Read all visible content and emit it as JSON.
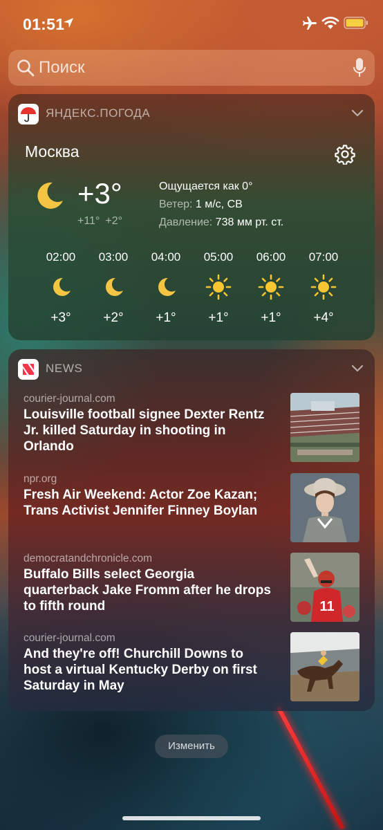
{
  "status": {
    "time": "01:51"
  },
  "search": {
    "placeholder": "Поиск"
  },
  "weather": {
    "app_name": "ЯНДЕКС.ПОГОДА",
    "city": "Москва",
    "current_temp": "+3°",
    "high": "+11°",
    "low": "+2°",
    "feels_like": "Ощущается как 0°",
    "wind_label": "Ветер:",
    "wind_value": "1 м/с, СВ",
    "pressure_label": "Давление:",
    "pressure_value": "738 мм рт. ст.",
    "hourly": [
      {
        "hour": "02:00",
        "icon": "moon-icon",
        "temp": "+3°"
      },
      {
        "hour": "03:00",
        "icon": "moon-icon",
        "temp": "+2°"
      },
      {
        "hour": "04:00",
        "icon": "moon-icon",
        "temp": "+1°"
      },
      {
        "hour": "05:00",
        "icon": "sun-icon",
        "temp": "+1°"
      },
      {
        "hour": "06:00",
        "icon": "sun-icon",
        "temp": "+1°"
      },
      {
        "hour": "07:00",
        "icon": "sun-icon",
        "temp": "+4°"
      }
    ]
  },
  "news": {
    "app_name": "NEWS",
    "items": [
      {
        "source": "courier-journal.com",
        "headline": "Louisville football signee Dexter Rentz Jr. killed Saturday in shooting in Orlando",
        "thumb": "stadium"
      },
      {
        "source": "npr.org",
        "headline": "Fresh Air Weekend: Actor Zoe Kazan; Trans Activist Jennifer Finney Boylan",
        "thumb": "portrait"
      },
      {
        "source": "democratandchronicle.com",
        "headline": "Buffalo Bills select Georgia quarterback Jake Fromm after he drops to fifth round",
        "thumb": "football-player"
      },
      {
        "source": "courier-journal.com",
        "headline": "And they're off! Churchill Downs to host a virtual Kentucky Derby on first Saturday in May",
        "thumb": "horse-race"
      }
    ]
  },
  "edit_button": "Изменить",
  "colors": {
    "sun": "#f7c631",
    "moon": "#f4c542",
    "battery": "#f5d142",
    "yandex_red": "#e8322d",
    "news_red": "#f5364a"
  }
}
